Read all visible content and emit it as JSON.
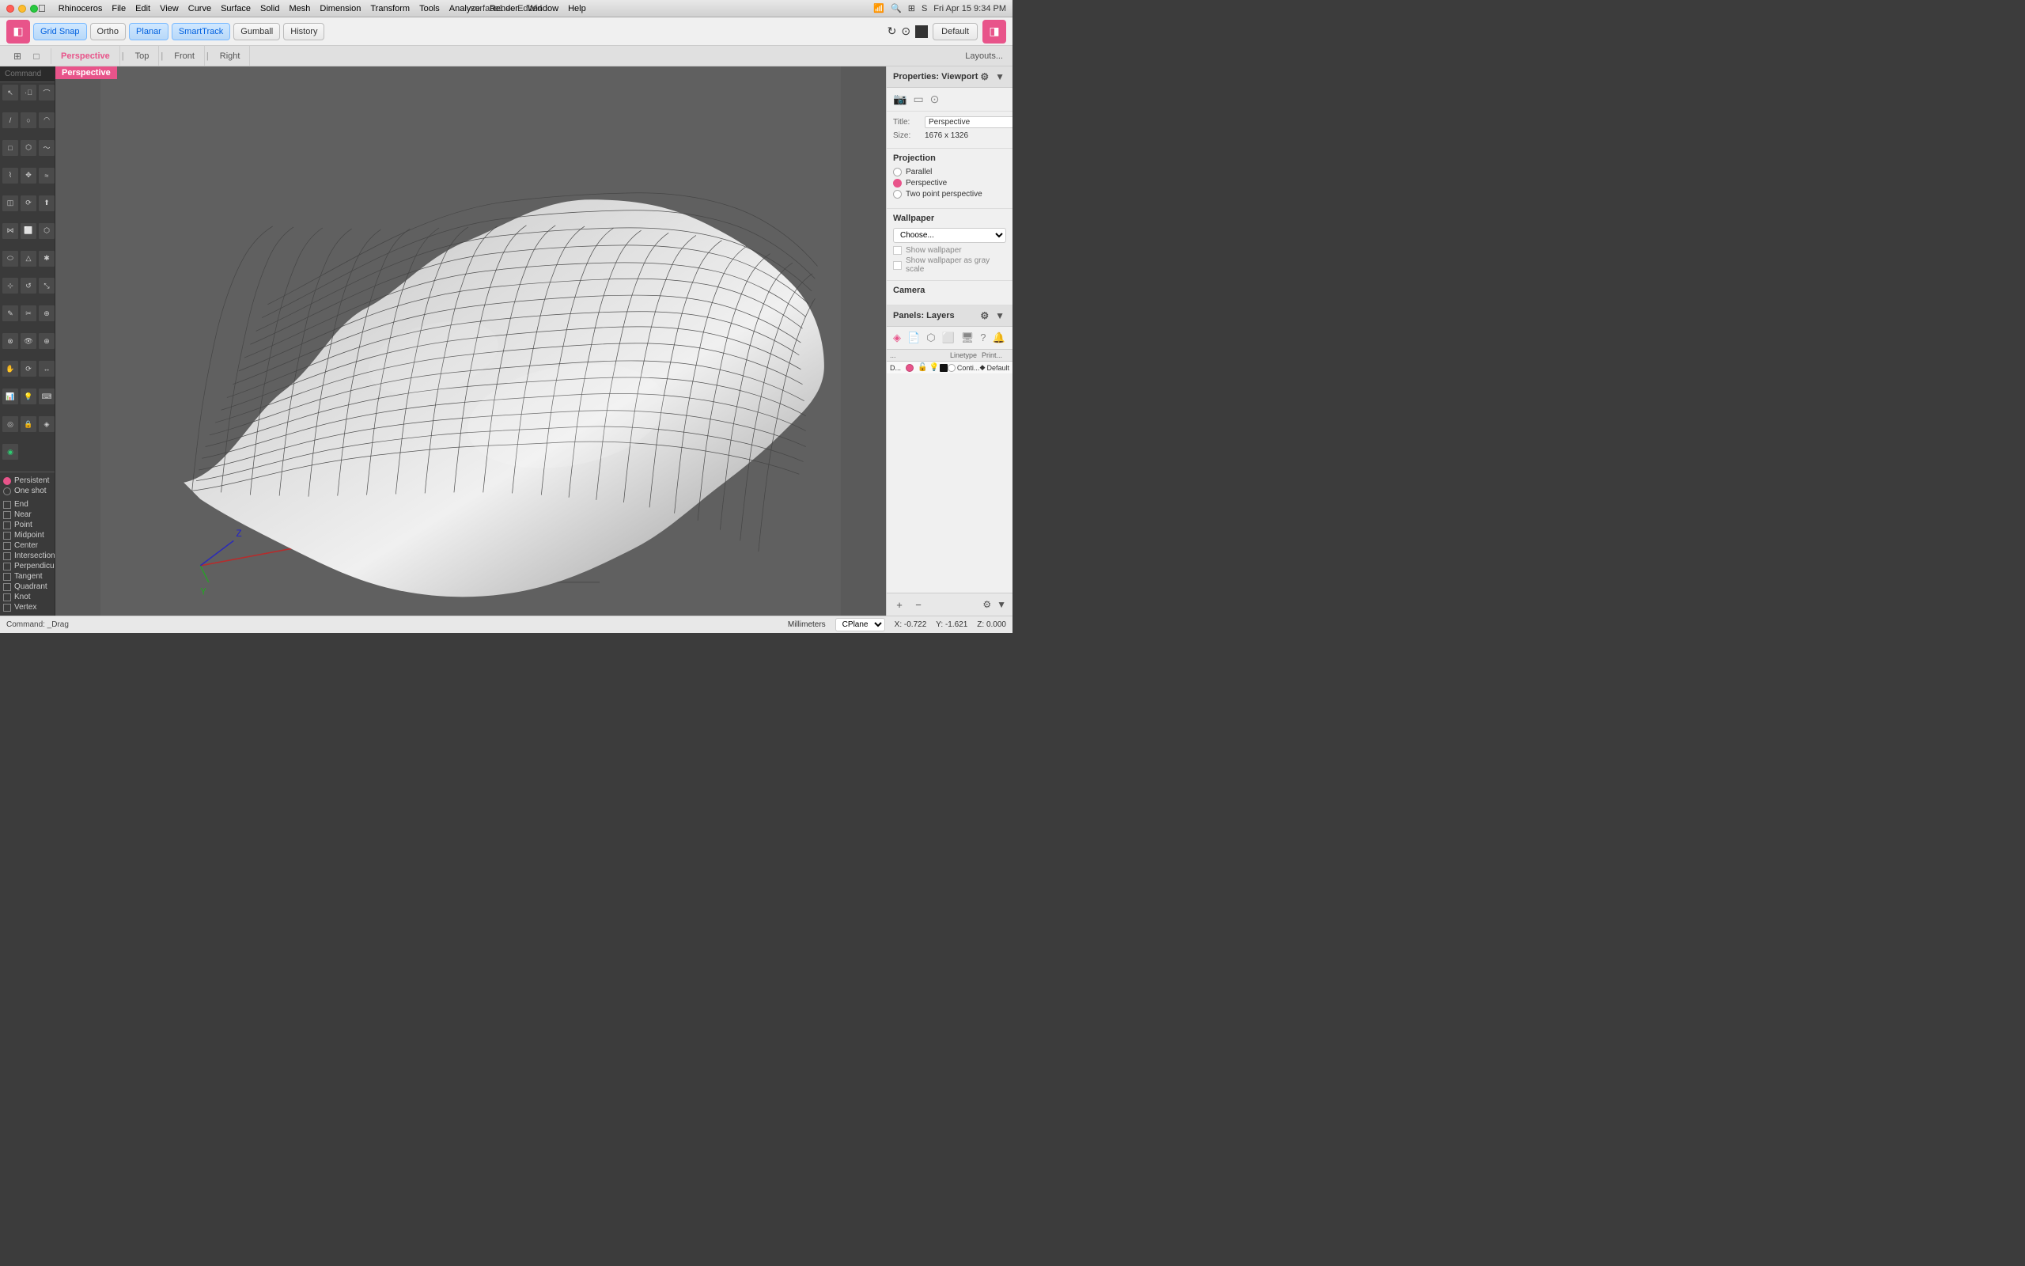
{
  "titlebar": {
    "app": "Rhinoceros",
    "menus": [
      "File",
      "Edit",
      "View",
      "Curve",
      "Surface",
      "Solid",
      "Mesh",
      "Dimension",
      "Transform",
      "Tools",
      "Analyze",
      "Render",
      "Window",
      "Help"
    ],
    "title": "surface1",
    "subtitle": "Edited",
    "time": "Fri Apr 15  9:34 PM"
  },
  "toolbar": {
    "buttons": [
      "Grid Snap",
      "Ortho",
      "Planar",
      "SmartTrack",
      "Gumball",
      "History"
    ],
    "default_label": "Default"
  },
  "viewport_tabs": {
    "tabs": [
      "Perspective",
      "Top",
      "Front",
      "Right"
    ],
    "active": "Perspective",
    "layouts_label": "Layouts..."
  },
  "command": {
    "placeholder": "Command",
    "current": "_Drag"
  },
  "snap_panel": {
    "persistent_label": "Persistent",
    "one_shot_label": "One shot",
    "items": [
      "End",
      "Near",
      "Point",
      "Midpoint",
      "Center",
      "Intersection",
      "Perpendicular",
      "Tangent",
      "Quadrant",
      "Knot",
      "Vertex"
    ]
  },
  "properties": {
    "panel_title": "Properties: Viewport",
    "title_label": "Title:",
    "title_value": "Perspective",
    "size_label": "Size:",
    "size_value": "1676 x 1326",
    "projection_label": "Projection",
    "projection_options": [
      "Parallel",
      "Perspective",
      "Two point perspective"
    ],
    "projection_selected": "Perspective",
    "wallpaper_label": "Wallpaper",
    "wallpaper_choose": "Choose...",
    "show_wallpaper": "Show wallpaper",
    "show_wallpaper_gray": "Show wallpaper as gray scale",
    "camera_label": "Camera"
  },
  "layers": {
    "panel_title": "Panels: Layers",
    "col_linetype": "Linetype",
    "col_print": "Print...",
    "rows": [
      {
        "name": "D...",
        "linetype": "Conti...",
        "print": "Default"
      }
    ]
  },
  "status_bar": {
    "command": "Command: _Drag",
    "units": "Millimeters",
    "cplane": "CPlane",
    "x": "X: -0.722",
    "y": "Y: -1.621",
    "z": "Z: 0.000"
  }
}
